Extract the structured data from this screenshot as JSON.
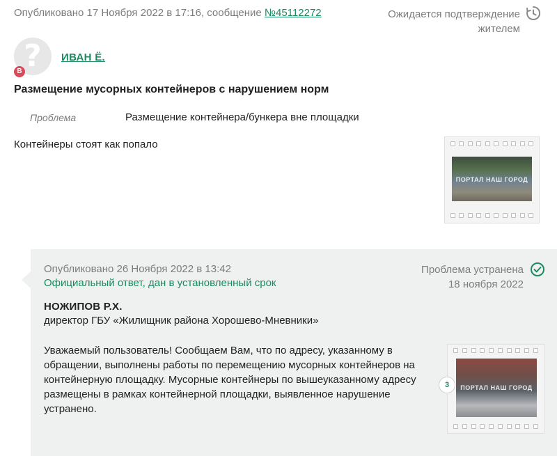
{
  "post": {
    "published_prefix": "Опубликовано 17 Ноября 2022 в 17:16, сообщение",
    "message_number": "№45112272",
    "status_line1": "Ожидается подтверждение",
    "status_line2": "жителем",
    "author_badge": "В",
    "author": "ИВАН Ё.",
    "title": "Размещение мусорных контейнеров с нарушением норм",
    "problem_label": "Проблема",
    "problem_value": "Размещение контейнера/бункера вне площадки",
    "text": "Контейнеры стоят как попало",
    "photo_watermark": "ПОРТАЛ НАШ ГОРОД"
  },
  "answer": {
    "published": "Опубликовано 26 Ноября 2022 в 13:42",
    "official": "Официальный ответ, дан в установленный срок",
    "status": "Проблема устранена",
    "status_date": "18 ноября 2022",
    "name": "НОЖИПОВ Р.Х.",
    "position": "директор ГБУ «Жилищник района Хорошево-Мневники»",
    "text": "Уважаемый пользователь! Сообщаем Вам, что по адресу, указанному в обращении, выполнены работы по перемещению мусорных контейнеров на контейнерную площадку. Мусорные контейнеры по вышеуказанному адресу размещены в рамках контейнерной площадки, выявленное нарушение устранено.",
    "photo_count": "3",
    "photo_watermark": "ПОРТАЛ НАШ ГОРОД"
  },
  "colors": {
    "accent": "#1a8a5f",
    "answer_bg": "#eef1f0",
    "badge": "#d94a5a"
  },
  "icons": {
    "pending": "clock-history-icon",
    "resolved": "check-circle-icon",
    "avatar": "question-mark-icon"
  }
}
